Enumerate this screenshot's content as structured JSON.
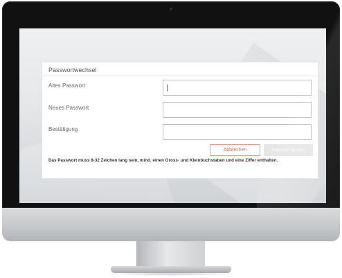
{
  "dialog": {
    "title": "Passwortwechsel",
    "fields": [
      {
        "label": "Altes Passwort",
        "value": ""
      },
      {
        "label": "Neues Passwort",
        "value": ""
      },
      {
        "label": "Bestätigung",
        "value": ""
      }
    ],
    "buttons": {
      "cancel_label": "Abbrechen",
      "submit_label": "Passwort ändern"
    },
    "hint": "Das Passwort muss 8-32 Zeichen lang sein, mind. einen Gross- und Kleinbuchstaben und eine Ziffer enthalten."
  },
  "colors": {
    "cancel_accent": "#d66b4e",
    "submit_disabled_bg": "#e6e6e6"
  }
}
